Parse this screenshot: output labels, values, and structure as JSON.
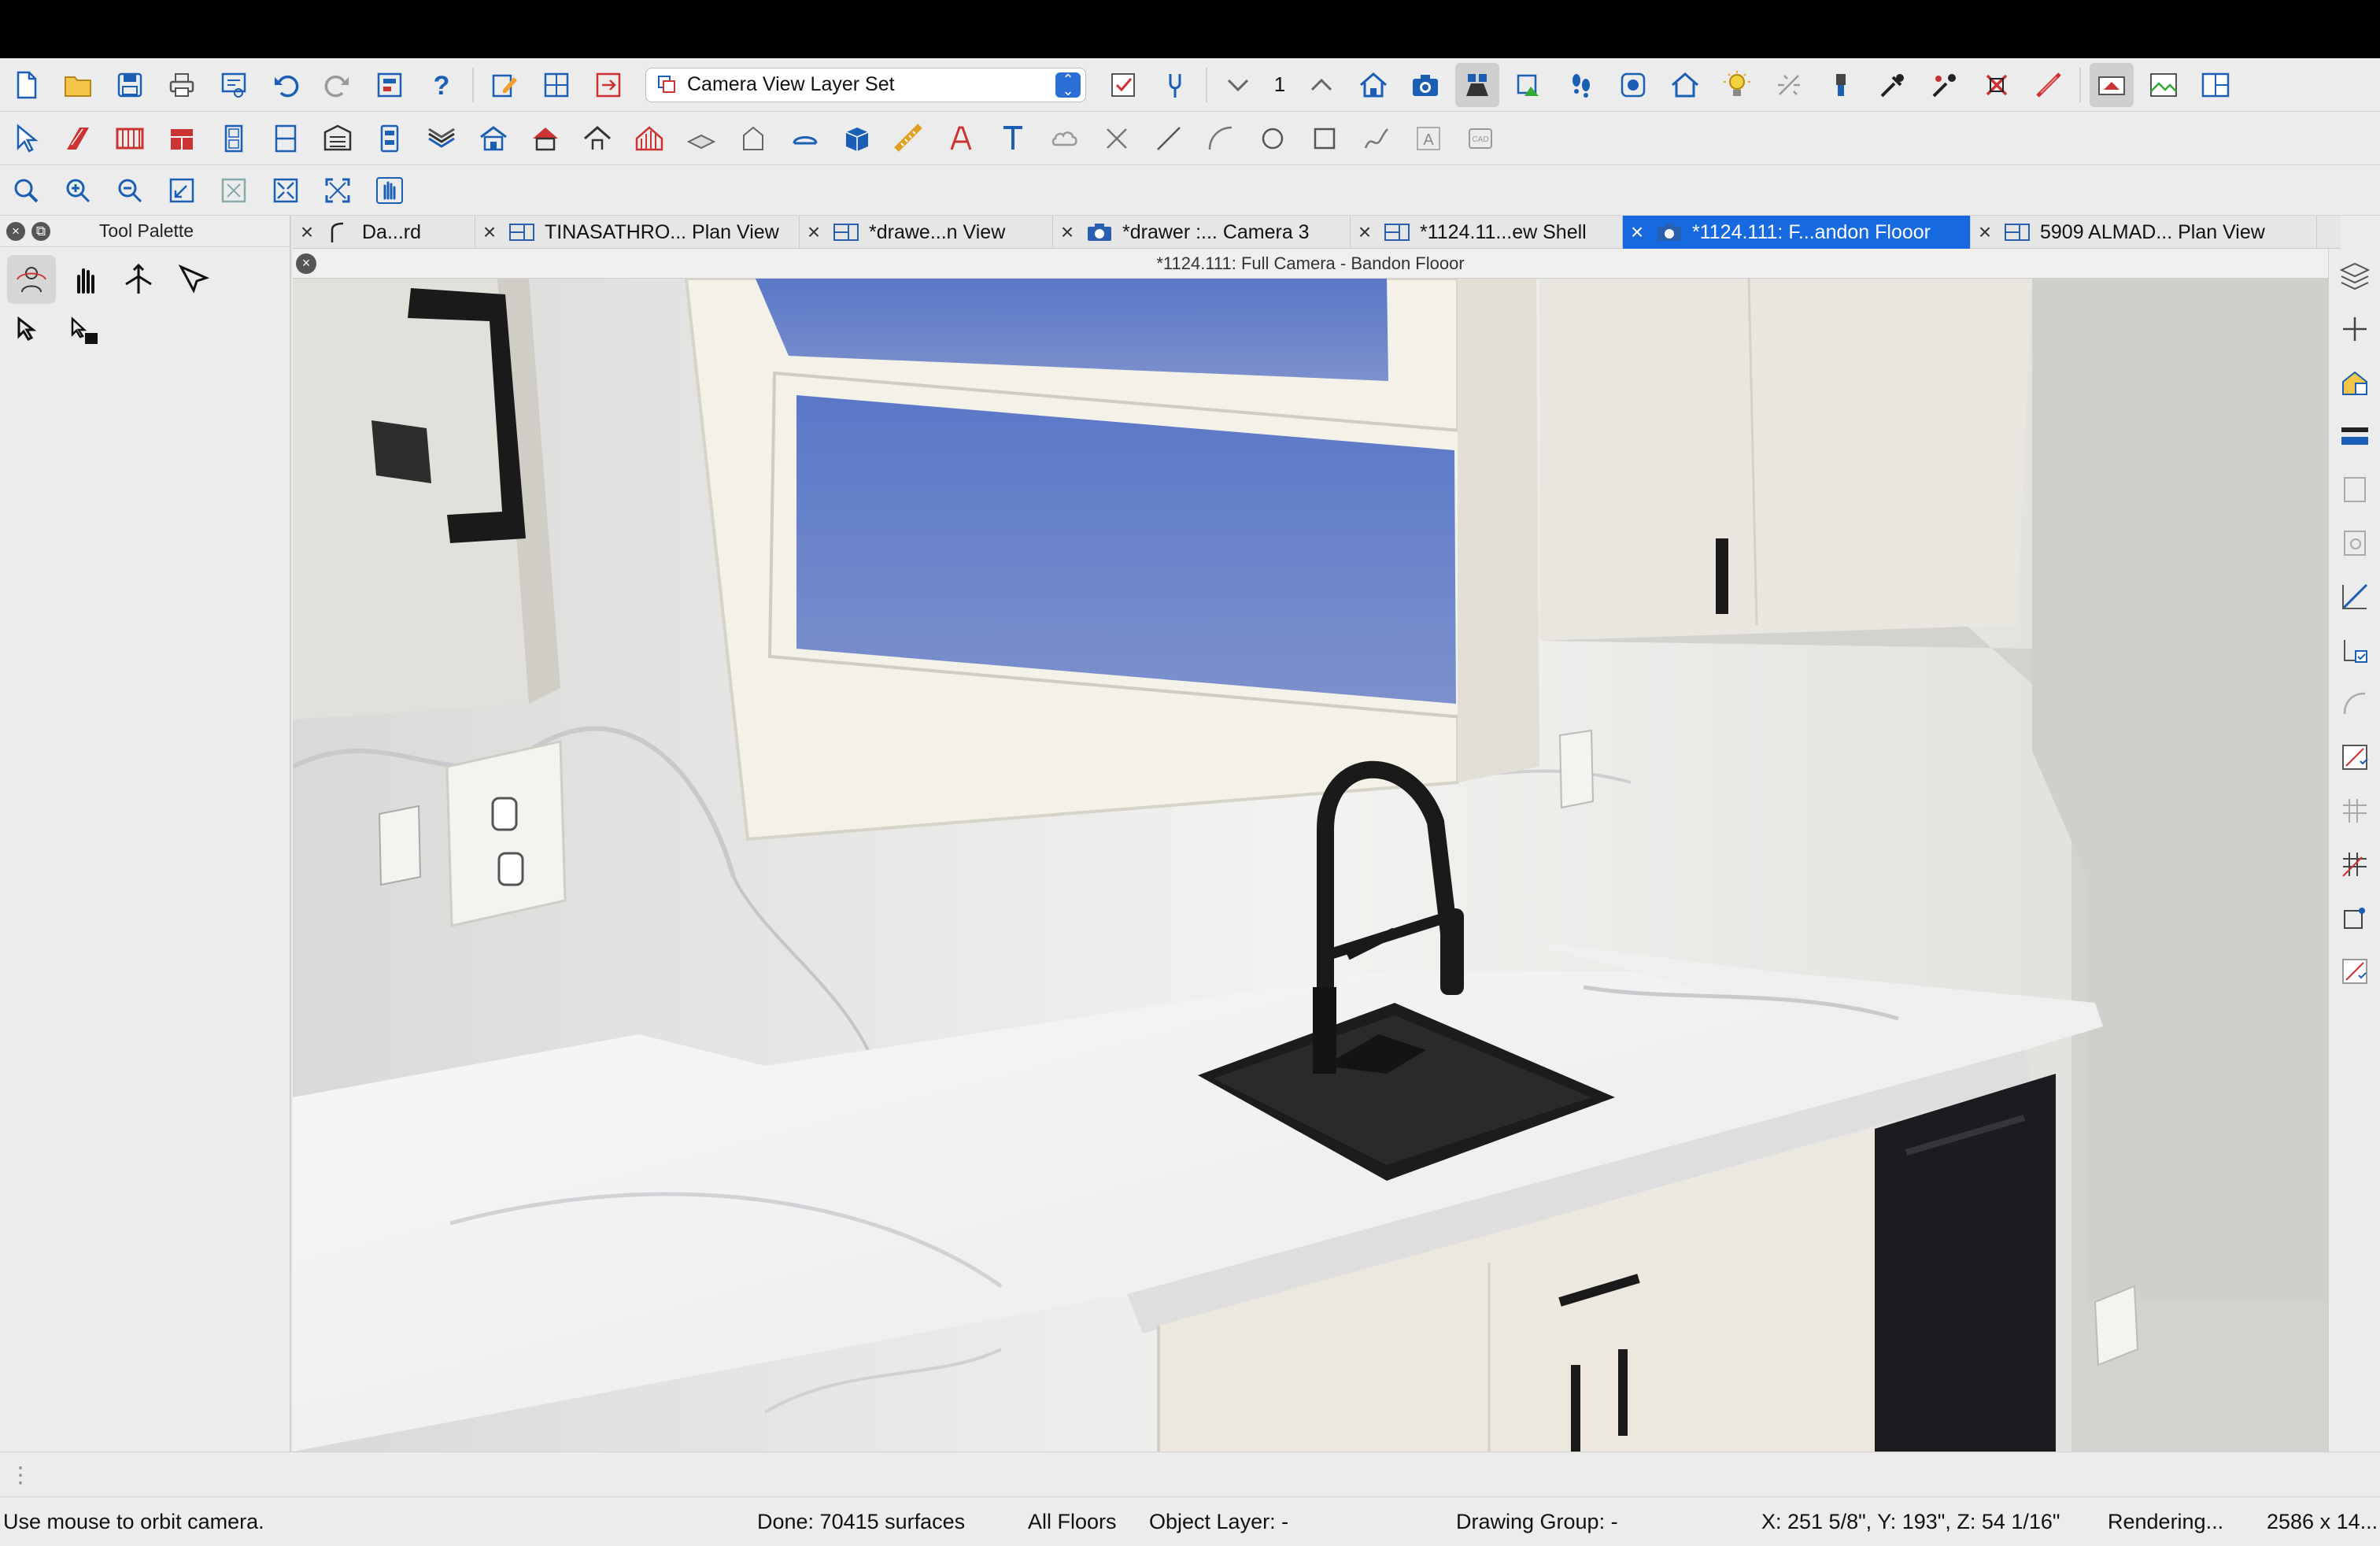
{
  "toolbar": {
    "layer_set": "Camera View Layer Set",
    "floor_number": "1"
  },
  "palette": {
    "title": "Tool Palette"
  },
  "tabs": [
    {
      "label": "Da...rd",
      "icon": "arc-icon",
      "active": false
    },
    {
      "label": "TINASATHRO... Plan View",
      "icon": "plan-view-icon",
      "active": false
    },
    {
      "label": "*drawe...n View",
      "icon": "plan-view-icon",
      "active": false
    },
    {
      "label": "*drawer :... Camera 3",
      "icon": "camera-icon",
      "active": false
    },
    {
      "label": "*1124.11...ew Shell",
      "icon": "plan-view-icon",
      "active": false
    },
    {
      "label": "*1124.111: F...andon Flooor",
      "icon": "camera-icon",
      "active": true
    },
    {
      "label": "5909 ALMAD... Plan View",
      "icon": "plan-view-icon",
      "active": false
    }
  ],
  "view": {
    "title": "*1124.111: Full Camera - Bandon Flooor"
  },
  "status": {
    "hint": "Use mouse to orbit camera.",
    "done": "Done:  70415 surfaces",
    "floors": "All Floors",
    "object_layer": "Object Layer: -",
    "drawing_group": "Drawing Group: -",
    "coords": "X: 251 5/8\", Y: 193\", Z: 54 1/16\"",
    "rendering": "Rendering...",
    "size": "2586 x 14..."
  },
  "colors": {
    "accent": "#1769e0",
    "toolbar_bg": "#ececec",
    "sky": "#7088c8",
    "wall": "#e6e6e2",
    "cabinet": "#ebe7df",
    "dishwasher": "#1b1c1f"
  }
}
